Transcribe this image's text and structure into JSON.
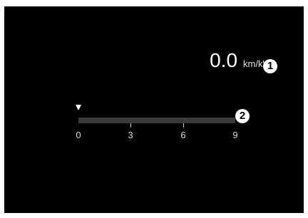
{
  "economy": {
    "value": "0.0",
    "unit": "km/kWh"
  },
  "callouts": {
    "one": "1",
    "two": "2"
  },
  "gauge": {
    "min": 0,
    "max": 9,
    "current": 0,
    "ticks": [
      "0",
      "3",
      "6",
      "9"
    ]
  },
  "colors": {
    "background": "#000000",
    "text": "#ffffff",
    "track": "#3a3a3a"
  }
}
